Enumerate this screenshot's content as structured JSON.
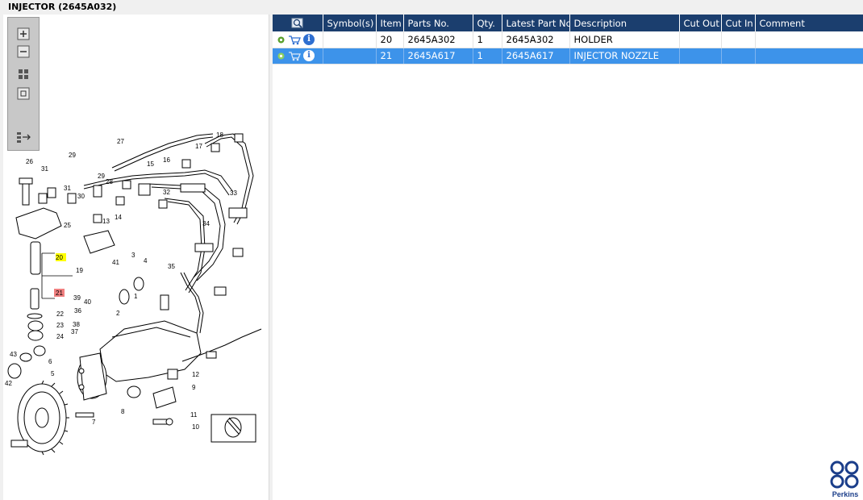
{
  "window": {
    "title": "INJECTOR (2645A032)"
  },
  "toolbar": {
    "zoom_in_icon": "zoom-in-icon",
    "zoom_out_icon": "zoom-out-icon",
    "fit_icon": "fit-page-icon",
    "actual_size_icon": "actual-size-icon",
    "export_icon": "export-icon"
  },
  "diagram": {
    "callouts": [
      "26",
      "31",
      "29",
      "27",
      "18",
      "17",
      "16",
      "15",
      "29",
      "28",
      "31",
      "30",
      "32",
      "14",
      "13",
      "33",
      "25",
      "34",
      "20",
      "19",
      "41",
      "3",
      "4",
      "35",
      "21",
      "39",
      "40",
      "2",
      "1",
      "22",
      "36",
      "23",
      "38",
      "24",
      "37",
      "43",
      "6",
      "12",
      "5",
      "42",
      "9",
      "8",
      "11",
      "7",
      "10"
    ],
    "highlighted": {
      "20": "#ffff00",
      "21": "#f08080"
    }
  },
  "table": {
    "columns": [
      "",
      "Symbol(s)",
      "Item",
      "Parts No.",
      "Qty.",
      "Latest Part No.",
      "Description",
      "Cut Out",
      "Cut In",
      "Comment"
    ],
    "rows": [
      {
        "item": "20",
        "parts_no": "2645A302",
        "qty": "1",
        "latest": "2645A302",
        "description": "HOLDER",
        "cut_out": "",
        "cut_in": "",
        "comment": ""
      },
      {
        "item": "21",
        "parts_no": "2645A617",
        "qty": "1",
        "latest": "2645A617",
        "description": "INJECTOR NOZZLE",
        "cut_out": "",
        "cut_in": "",
        "comment": ""
      }
    ]
  },
  "brand": {
    "name": "Perkins",
    "color": "#1b3e8a"
  },
  "colors": {
    "header": "#1b3e6e",
    "selected_row": "#3d93ea"
  }
}
